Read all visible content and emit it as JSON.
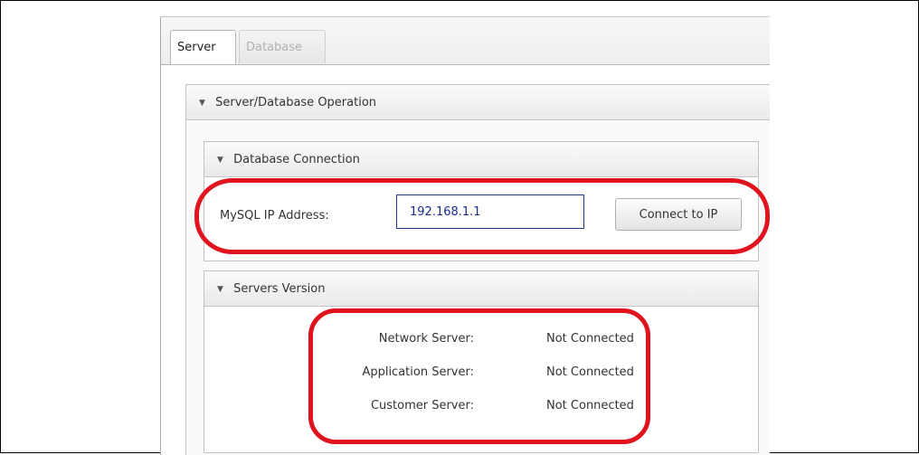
{
  "tabs": [
    {
      "label": "Server",
      "active": true
    },
    {
      "label": "Database",
      "active": false
    }
  ],
  "outer_pane": {
    "title": "Server/Database Operation"
  },
  "db_connection": {
    "title": "Database Connection",
    "ip_label": "MySQL IP Address:",
    "ip_value": "192.168.1.1",
    "connect_button": "Connect to IP"
  },
  "servers_version": {
    "title": "Servers Version",
    "rows": [
      {
        "label": "Network Server:",
        "value": "Not Connected"
      },
      {
        "label": "Application Server:",
        "value": "Not Connected"
      },
      {
        "label": "Customer Server:",
        "value": "Not Connected"
      }
    ]
  },
  "colors": {
    "annotation": "#e0141e",
    "input_border": "#1e3a8a",
    "input_text": "#1a2b8c"
  },
  "icons": {
    "collapse": "triangle-down-icon"
  }
}
